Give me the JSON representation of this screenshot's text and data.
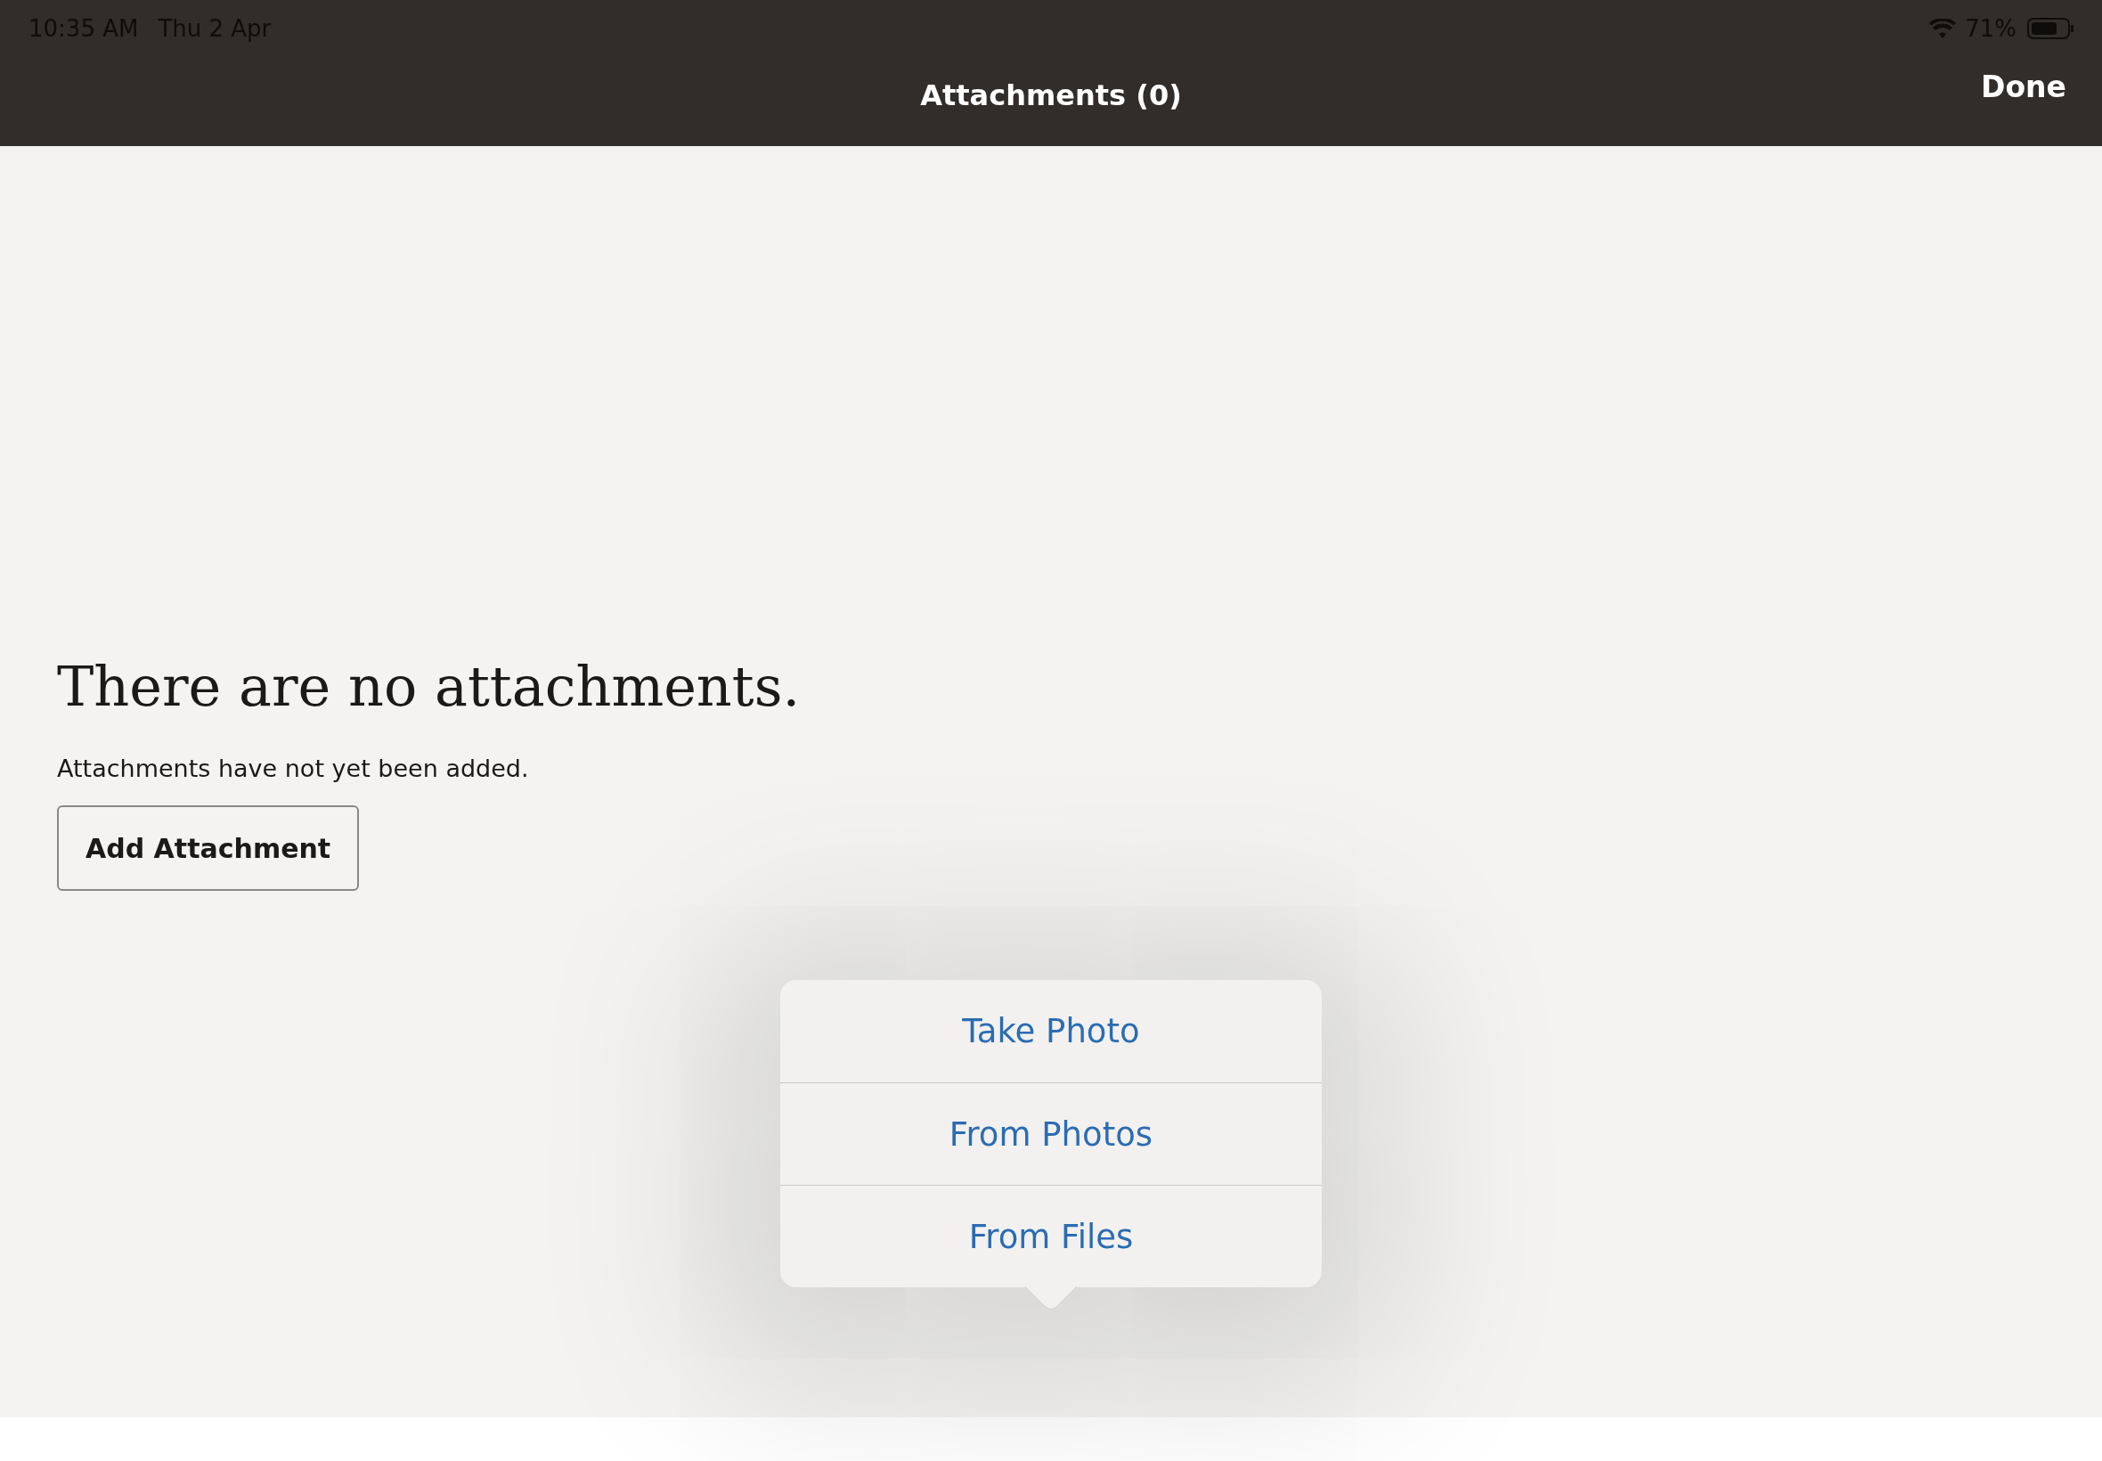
{
  "status_bar": {
    "time": "10:35 AM",
    "date": "Thu 2 Apr",
    "battery": "71%"
  },
  "nav_bar": {
    "title": "Attachments (0)",
    "done": "Done"
  },
  "empty_state": {
    "heading": "There are no attachments.",
    "message": "Attachments have not yet been added.",
    "button": "Add Attachment"
  },
  "popover": {
    "items": [
      {
        "label": "Take Photo"
      },
      {
        "label": "From Photos"
      },
      {
        "label": "From Files"
      }
    ]
  }
}
